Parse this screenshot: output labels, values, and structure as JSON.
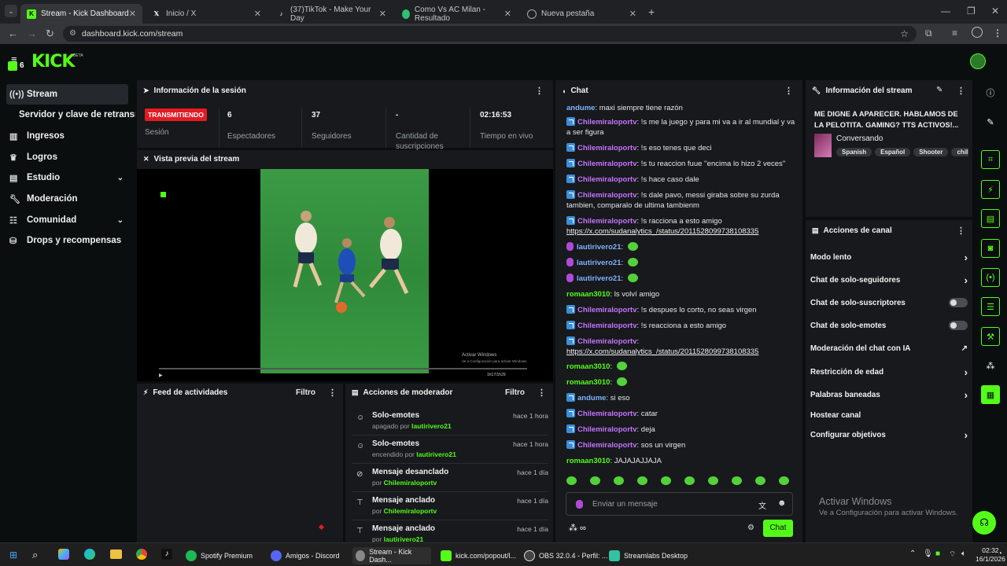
{
  "browser": {
    "tabs": [
      {
        "label": "Stream - Kick Dashboard",
        "active": true
      },
      {
        "label": "Inicio / X",
        "active": false
      },
      {
        "label": "(37)TikTok - Make Your Day",
        "active": false
      },
      {
        "label": "Como Vs AC Milan - Resultado",
        "active": false
      },
      {
        "label": "Nueva pestaña",
        "active": false
      }
    ],
    "url": "dashboard.kick.com/stream"
  },
  "kick": {
    "logo": "KICK",
    "beta": "BETA",
    "level_badge": "6"
  },
  "sidebar": {
    "items": [
      {
        "label": "Stream",
        "icon": "broadcast-icon",
        "active": true
      },
      {
        "label": "Servidor y clave de retransm",
        "icon": "",
        "sub": true
      },
      {
        "label": "Ingresos",
        "icon": "chart-icon"
      },
      {
        "label": "Logros",
        "icon": "trophy-icon"
      },
      {
        "label": "Estudio",
        "icon": "studio-icon",
        "expandable": true
      },
      {
        "label": "Moderación",
        "icon": "wrench-icon"
      },
      {
        "label": "Comunidad",
        "icon": "community-icon",
        "expandable": true
      },
      {
        "label": "Drops y recompensas",
        "icon": "drops-icon"
      }
    ]
  },
  "session": {
    "title": "Información de la sesión",
    "badge": "TRANSMITIENDO",
    "session_label": "Sesión",
    "stats": [
      {
        "value": "6",
        "label": "Espectadores"
      },
      {
        "value": "37",
        "label": "Seguidores"
      },
      {
        "value": "-",
        "label": "Cantidad de suscripciones"
      },
      {
        "value": "02:16:53",
        "label": "Tiempo en vivo"
      }
    ]
  },
  "preview": {
    "title": "Vista previa del stream",
    "watermark_title": "Activar Windows",
    "watermark_sub": "Ve a Configuración para activar Windows.",
    "time": "1h17/1h29"
  },
  "activity": {
    "title": "Feed de actividades",
    "filter": "Filtro"
  },
  "mod": {
    "title": "Acciones de moderador",
    "filter": "Filtro",
    "rows": [
      {
        "title": "Solo-emotes",
        "sub_prefix": "apagado por",
        "user": "lautirivero21",
        "time": "hace 1 hora",
        "icon": "emote-icon"
      },
      {
        "title": "Solo-emotes",
        "sub_prefix": "encendido por",
        "user": "lautirivero21",
        "time": "hace 1 hora",
        "icon": "emote-icon"
      },
      {
        "title": "Mensaje desanclado",
        "sub_prefix": "por",
        "user": "Chilemiraloportv",
        "time": "hace 1 día",
        "icon": "unpin-icon"
      },
      {
        "title": "Mensaje anclado",
        "sub_prefix": "por",
        "user": "Chilemiraloportv",
        "time": "hace 1 día",
        "icon": "pin-icon"
      },
      {
        "title": "Mensaje anclado",
        "sub_prefix": "por",
        "user": "lautirivero21",
        "time": "hace 1 día",
        "icon": "pin-icon"
      }
    ]
  },
  "chat": {
    "title": "Chat",
    "messages": [
      {
        "user": "andume",
        "color": "#7fb3ff",
        "badge": "none",
        "text": "maxi siempre tiene razón"
      },
      {
        "user": "Chilemiraloportv",
        "color": "#c674ff",
        "badge": "mod",
        "text": "!s me la juego y para mi va a ir al mundial y va a ser figura"
      },
      {
        "user": "Chilemiraloportv",
        "color": "#c674ff",
        "badge": "mod",
        "text": "!s eso tenes que deci"
      },
      {
        "user": "Chilemiraloportv",
        "color": "#c674ff",
        "badge": "mod",
        "text": "!s tu reaccion fuue ''encima lo hizo 2 veces''"
      },
      {
        "user": "Chilemiraloportv",
        "color": "#c674ff",
        "badge": "mod",
        "text": "!s hace caso dale"
      },
      {
        "user": "Chilemiraloportv",
        "color": "#c674ff",
        "badge": "mod",
        "text": "!s dale pavo, messi giraba sobre su zurda tambien, comparalo de ultima tambienm"
      },
      {
        "user": "Chilemiraloportv",
        "color": "#c674ff",
        "badge": "mod",
        "text": "!s racciona a esto amigo",
        "link": "https://x.com/sudanalytics_/status/2011528099738108335"
      },
      {
        "user": "lautirivero21",
        "color": "#7fb3ff",
        "badge": "mic",
        "text": "",
        "emote": true
      },
      {
        "user": "lautirivero21",
        "color": "#7fb3ff",
        "badge": "mic",
        "text": "",
        "emote": true
      },
      {
        "user": "lautirivero21",
        "color": "#7fb3ff",
        "badge": "mic",
        "text": "",
        "emote": true
      },
      {
        "user": "romaan3010",
        "color": "#53fc18",
        "badge": "none",
        "text": "ls volví amigo"
      },
      {
        "user": "Chilemiraloportv",
        "color": "#c674ff",
        "badge": "mod",
        "text": "!s despues lo corto, no seas virgen"
      },
      {
        "user": "Chilemiraloportv",
        "color": "#c674ff",
        "badge": "mod",
        "text": "!s reacciona a esto amigo"
      },
      {
        "user": "Chilemiraloportv",
        "color": "#c674ff",
        "badge": "mod",
        "text": "",
        "link": "https://x.com/sudanalytics_/status/2011528099738108335"
      },
      {
        "user": "romaan3010",
        "color": "#53fc18",
        "badge": "none",
        "text": "",
        "emote": true
      },
      {
        "user": "romaan3010",
        "color": "#53fc18",
        "badge": "none",
        "text": "",
        "emote": true
      },
      {
        "user": "andume",
        "color": "#7fb3ff",
        "badge": "mod",
        "text": "si eso"
      },
      {
        "user": "Chilemiraloportv",
        "color": "#c674ff",
        "badge": "mod",
        "text": "catar"
      },
      {
        "user": "Chilemiraloportv",
        "color": "#c674ff",
        "badge": "mod",
        "text": "deja"
      },
      {
        "user": "Chilemiraloportv",
        "color": "#c674ff",
        "badge": "mod",
        "text": "sos un virgen"
      },
      {
        "user": "romaan3010",
        "color": "#53fc18",
        "badge": "none",
        "text": "JAJAJAJJAJA"
      }
    ],
    "placeholder": "Enviar un mensaje",
    "send_label": "Chat"
  },
  "stream_info": {
    "title": "Información del stream",
    "stream_title": "ME DIGNE A APARECER. HABLAMOS DE LA PELOTITA. GAMING? TTS ACTIVOS!...",
    "category": "Conversando",
    "tags": [
      "Spanish",
      "Español",
      "Shooter",
      "chill"
    ]
  },
  "channel_actions": {
    "title": "Acciones de canal",
    "items": [
      {
        "label": "Modo lento",
        "control": "arrow"
      },
      {
        "label": "Chat de solo-seguidores",
        "control": "arrow"
      },
      {
        "label": "Chat de solo-suscriptores",
        "control": "toggle"
      },
      {
        "label": "Chat de solo-emotes",
        "control": "toggle"
      },
      {
        "label": "Moderación del chat con IA",
        "control": "external"
      },
      {
        "label": "Restricción de edad",
        "control": "arrow"
      },
      {
        "label": "Palabras baneadas",
        "control": "arrow"
      },
      {
        "label": "Hostear canal",
        "control": "none"
      },
      {
        "label": "Configurar objetivos",
        "control": "arrow"
      }
    ]
  },
  "watermark": {
    "title": "Activar Windows",
    "sub": "Ve a Configuración para activar Windows."
  },
  "taskbar": {
    "apps": [
      {
        "label": "Spotify Premium",
        "color": "#1db954"
      },
      {
        "label": "Amigos - Discord",
        "color": "#5865f2"
      },
      {
        "label": "Stream - Kick Dash...",
        "color": "#888888",
        "active": true
      },
      {
        "label": "kick.com/popout/l...",
        "color": "#53fc18"
      },
      {
        "label": "OBS 32.0.4 - Perfil: ...",
        "color": "#444444"
      },
      {
        "label": "Streamlabs Desktop",
        "color": "#31c3a2"
      }
    ],
    "time": "02:32",
    "date": "16/1/2026"
  },
  "colors": {
    "accent": "#53fc18",
    "live": "#e31b23",
    "panel": "#17191c",
    "bg": "#0b0e0f"
  }
}
